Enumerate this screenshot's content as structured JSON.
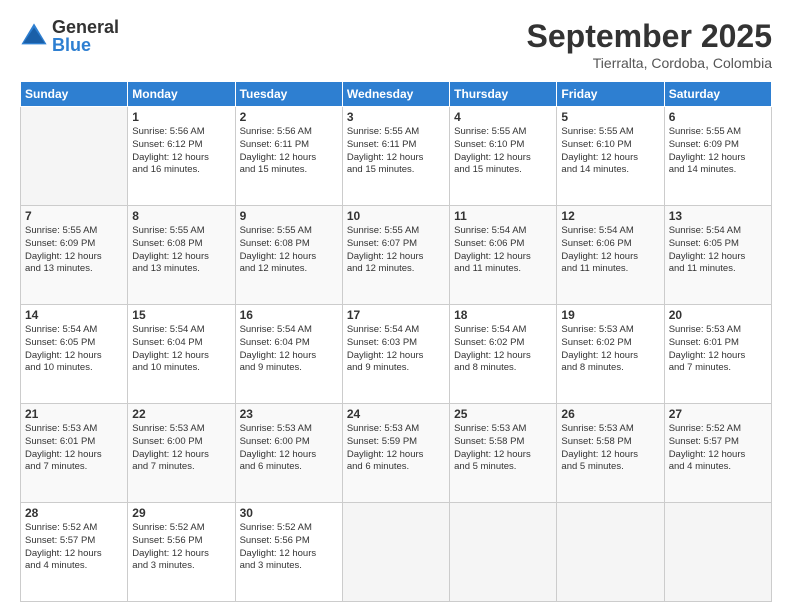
{
  "header": {
    "logo_general": "General",
    "logo_blue": "Blue",
    "month_title": "September 2025",
    "location": "Tierralta, Cordoba, Colombia"
  },
  "days_of_week": [
    "Sunday",
    "Monday",
    "Tuesday",
    "Wednesday",
    "Thursday",
    "Friday",
    "Saturday"
  ],
  "weeks": [
    [
      {
        "day": "",
        "info": ""
      },
      {
        "day": "1",
        "info": "Sunrise: 5:56 AM\nSunset: 6:12 PM\nDaylight: 12 hours\nand 16 minutes."
      },
      {
        "day": "2",
        "info": "Sunrise: 5:56 AM\nSunset: 6:11 PM\nDaylight: 12 hours\nand 15 minutes."
      },
      {
        "day": "3",
        "info": "Sunrise: 5:55 AM\nSunset: 6:11 PM\nDaylight: 12 hours\nand 15 minutes."
      },
      {
        "day": "4",
        "info": "Sunrise: 5:55 AM\nSunset: 6:10 PM\nDaylight: 12 hours\nand 15 minutes."
      },
      {
        "day": "5",
        "info": "Sunrise: 5:55 AM\nSunset: 6:10 PM\nDaylight: 12 hours\nand 14 minutes."
      },
      {
        "day": "6",
        "info": "Sunrise: 5:55 AM\nSunset: 6:09 PM\nDaylight: 12 hours\nand 14 minutes."
      }
    ],
    [
      {
        "day": "7",
        "info": "Sunrise: 5:55 AM\nSunset: 6:09 PM\nDaylight: 12 hours\nand 13 minutes."
      },
      {
        "day": "8",
        "info": "Sunrise: 5:55 AM\nSunset: 6:08 PM\nDaylight: 12 hours\nand 13 minutes."
      },
      {
        "day": "9",
        "info": "Sunrise: 5:55 AM\nSunset: 6:08 PM\nDaylight: 12 hours\nand 12 minutes."
      },
      {
        "day": "10",
        "info": "Sunrise: 5:55 AM\nSunset: 6:07 PM\nDaylight: 12 hours\nand 12 minutes."
      },
      {
        "day": "11",
        "info": "Sunrise: 5:54 AM\nSunset: 6:06 PM\nDaylight: 12 hours\nand 11 minutes."
      },
      {
        "day": "12",
        "info": "Sunrise: 5:54 AM\nSunset: 6:06 PM\nDaylight: 12 hours\nand 11 minutes."
      },
      {
        "day": "13",
        "info": "Sunrise: 5:54 AM\nSunset: 6:05 PM\nDaylight: 12 hours\nand 11 minutes."
      }
    ],
    [
      {
        "day": "14",
        "info": "Sunrise: 5:54 AM\nSunset: 6:05 PM\nDaylight: 12 hours\nand 10 minutes."
      },
      {
        "day": "15",
        "info": "Sunrise: 5:54 AM\nSunset: 6:04 PM\nDaylight: 12 hours\nand 10 minutes."
      },
      {
        "day": "16",
        "info": "Sunrise: 5:54 AM\nSunset: 6:04 PM\nDaylight: 12 hours\nand 9 minutes."
      },
      {
        "day": "17",
        "info": "Sunrise: 5:54 AM\nSunset: 6:03 PM\nDaylight: 12 hours\nand 9 minutes."
      },
      {
        "day": "18",
        "info": "Sunrise: 5:54 AM\nSunset: 6:02 PM\nDaylight: 12 hours\nand 8 minutes."
      },
      {
        "day": "19",
        "info": "Sunrise: 5:53 AM\nSunset: 6:02 PM\nDaylight: 12 hours\nand 8 minutes."
      },
      {
        "day": "20",
        "info": "Sunrise: 5:53 AM\nSunset: 6:01 PM\nDaylight: 12 hours\nand 7 minutes."
      }
    ],
    [
      {
        "day": "21",
        "info": "Sunrise: 5:53 AM\nSunset: 6:01 PM\nDaylight: 12 hours\nand 7 minutes."
      },
      {
        "day": "22",
        "info": "Sunrise: 5:53 AM\nSunset: 6:00 PM\nDaylight: 12 hours\nand 7 minutes."
      },
      {
        "day": "23",
        "info": "Sunrise: 5:53 AM\nSunset: 6:00 PM\nDaylight: 12 hours\nand 6 minutes."
      },
      {
        "day": "24",
        "info": "Sunrise: 5:53 AM\nSunset: 5:59 PM\nDaylight: 12 hours\nand 6 minutes."
      },
      {
        "day": "25",
        "info": "Sunrise: 5:53 AM\nSunset: 5:58 PM\nDaylight: 12 hours\nand 5 minutes."
      },
      {
        "day": "26",
        "info": "Sunrise: 5:53 AM\nSunset: 5:58 PM\nDaylight: 12 hours\nand 5 minutes."
      },
      {
        "day": "27",
        "info": "Sunrise: 5:52 AM\nSunset: 5:57 PM\nDaylight: 12 hours\nand 4 minutes."
      }
    ],
    [
      {
        "day": "28",
        "info": "Sunrise: 5:52 AM\nSunset: 5:57 PM\nDaylight: 12 hours\nand 4 minutes."
      },
      {
        "day": "29",
        "info": "Sunrise: 5:52 AM\nSunset: 5:56 PM\nDaylight: 12 hours\nand 3 minutes."
      },
      {
        "day": "30",
        "info": "Sunrise: 5:52 AM\nSunset: 5:56 PM\nDaylight: 12 hours\nand 3 minutes."
      },
      {
        "day": "",
        "info": ""
      },
      {
        "day": "",
        "info": ""
      },
      {
        "day": "",
        "info": ""
      },
      {
        "day": "",
        "info": ""
      }
    ]
  ]
}
